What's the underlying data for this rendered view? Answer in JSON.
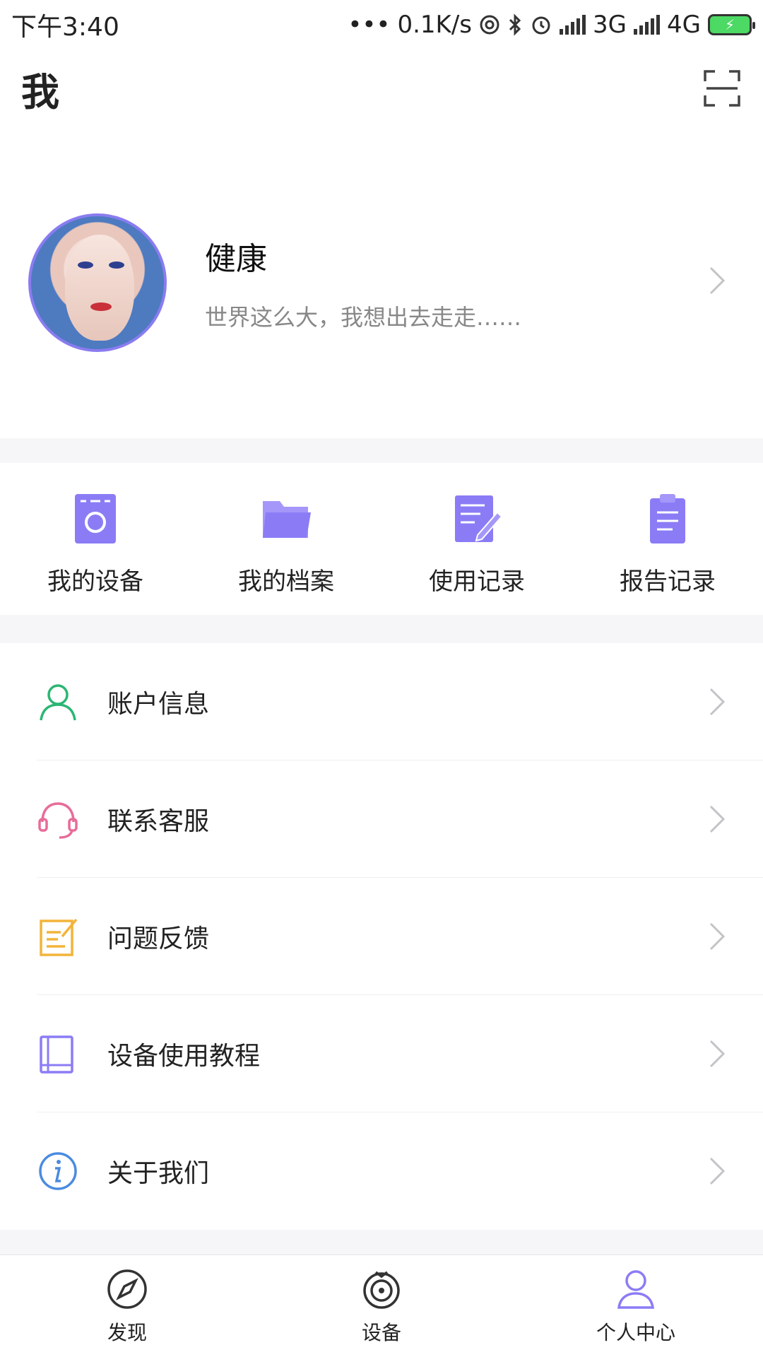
{
  "status_bar": {
    "time": "下午3:40",
    "dots": "•••",
    "speed": "0.1K/s",
    "net1": "3G",
    "net2": "4G"
  },
  "header": {
    "title": "我"
  },
  "profile": {
    "name": "健康",
    "motto": "世界这么大，我想出去走走……"
  },
  "quick_actions": [
    {
      "label": "我的设备",
      "icon": "device-icon"
    },
    {
      "label": "我的档案",
      "icon": "folder-icon"
    },
    {
      "label": "使用记录",
      "icon": "edit-record-icon"
    },
    {
      "label": "报告记录",
      "icon": "clipboard-icon"
    }
  ],
  "menu": [
    {
      "label": "账户信息",
      "icon": "user-icon"
    },
    {
      "label": "联系客服",
      "icon": "headset-icon"
    },
    {
      "label": "问题反馈",
      "icon": "feedback-icon"
    },
    {
      "label": "设备使用教程",
      "icon": "book-icon"
    },
    {
      "label": "关于我们",
      "icon": "info-icon"
    }
  ],
  "bottom_nav": [
    {
      "label": "发现",
      "icon": "compass-icon"
    },
    {
      "label": "设备",
      "icon": "device-signal-icon"
    },
    {
      "label": "个人中心",
      "icon": "person-icon"
    }
  ],
  "colors": {
    "accent": "#8b7cf6",
    "user_icon": "#2bb673",
    "headset_icon": "#e86c9a",
    "feedback_icon": "#f2b43a",
    "book_icon": "#8b7cf6",
    "info_icon": "#4a8be0"
  }
}
